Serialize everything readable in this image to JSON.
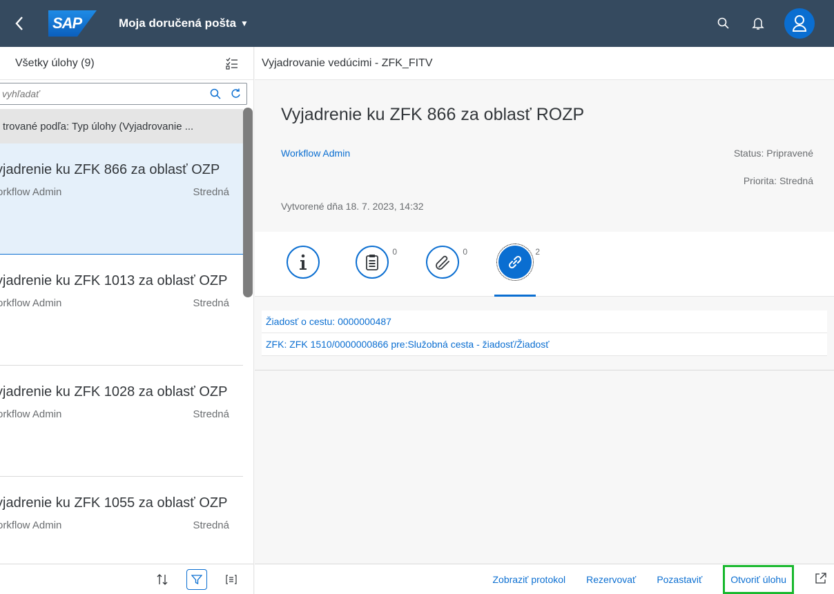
{
  "shell": {
    "logo": "SAP",
    "title": "Moja doručená pošta"
  },
  "master": {
    "header": "Všetky úlohy (9)",
    "search_placeholder": "vyhľadať",
    "filter_text": "trované podľa: Typ úlohy (Vyjadrovanie ...",
    "items": [
      {
        "title": "yjadrenie ku ZFK 866 za oblasť OZP",
        "creator": "orkflow Admin",
        "priority": "Stredná"
      },
      {
        "title": "yjadrenie ku ZFK 1013 za oblasť OZP",
        "creator": "orkflow Admin",
        "priority": "Stredná"
      },
      {
        "title": "yjadrenie ku ZFK 1028 za oblasť OZP",
        "creator": "orkflow Admin",
        "priority": "Stredná"
      },
      {
        "title": "yjadrenie ku ZFK 1055 za oblasť OZP",
        "creator": "orkflow Admin",
        "priority": "Stredná"
      }
    ]
  },
  "detail": {
    "header": "Vyjadrovanie vedúcimi - ZFK_FITV",
    "title": "Vyjadrenie ku ZFK 866 za oblasť ROZP",
    "creator": "Workflow Admin",
    "status": "Status: Pripravené",
    "priority": "Priorita: Stredná",
    "created": "Vytvorené dňa 18. 7. 2023, 14:32",
    "tab_counts": {
      "notes": "0",
      "attachments": "0",
      "links": "2"
    },
    "links": [
      "Žiadosť o cestu: 0000000487",
      "ZFK: ZFK 1510/0000000866 pre:Služobná cesta - žiadosť/Žiadosť"
    ],
    "footer": {
      "show_log": "Zobraziť protokol",
      "reserve": "Rezervovať",
      "suspend": "Pozastaviť",
      "open_task": "Otvoriť úlohu"
    }
  }
}
